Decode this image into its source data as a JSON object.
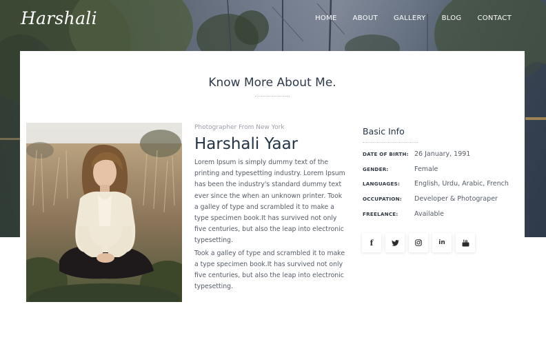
{
  "brand": {
    "logo_text": "Harshali"
  },
  "nav": {
    "items": [
      {
        "label": "HOME"
      },
      {
        "label": "ABOUT"
      },
      {
        "label": "GALLERY"
      },
      {
        "label": "BLOG"
      },
      {
        "label": "CONTACT"
      }
    ]
  },
  "about": {
    "section_title": "Know More About Me.",
    "tagline": "Photographer From New York",
    "name": "Harshali Yaar",
    "paragraphs": [
      "Lorem Ipsum is simply dummy text of the printing and typesetting industry. Lorem Ipsum has been the industry's standard dummy text ever since the when an unknown printer. Took a galley of type and scrambled it to make a type specimen book.It has survived not only five centuries, but also the leap into electronic typesetting.",
      "Took a galley of type and scrambled it to make a type specimen book.It has survived not only five centuries, but also the leap into electronic typesetting."
    ]
  },
  "basic_info": {
    "title": "Basic Info",
    "rows": [
      {
        "label": "DATE OF BIRTH:",
        "value": "26 January, 1991"
      },
      {
        "label": "GENDER:",
        "value": "Female"
      },
      {
        "label": "LANGUAGES:",
        "value": "English, Urdu, Arabic, French"
      },
      {
        "label": "OCCUPATION:",
        "value": "Developer & Photograper"
      },
      {
        "label": "FREELANCE:",
        "value": "Available"
      }
    ]
  },
  "socials": [
    {
      "icon": "facebook-icon",
      "glyph": "f"
    },
    {
      "icon": "twitter-icon"
    },
    {
      "icon": "instagram-icon"
    },
    {
      "icon": "linkedin-icon",
      "glyph": "in"
    },
    {
      "icon": "youtube-icon"
    }
  ]
}
